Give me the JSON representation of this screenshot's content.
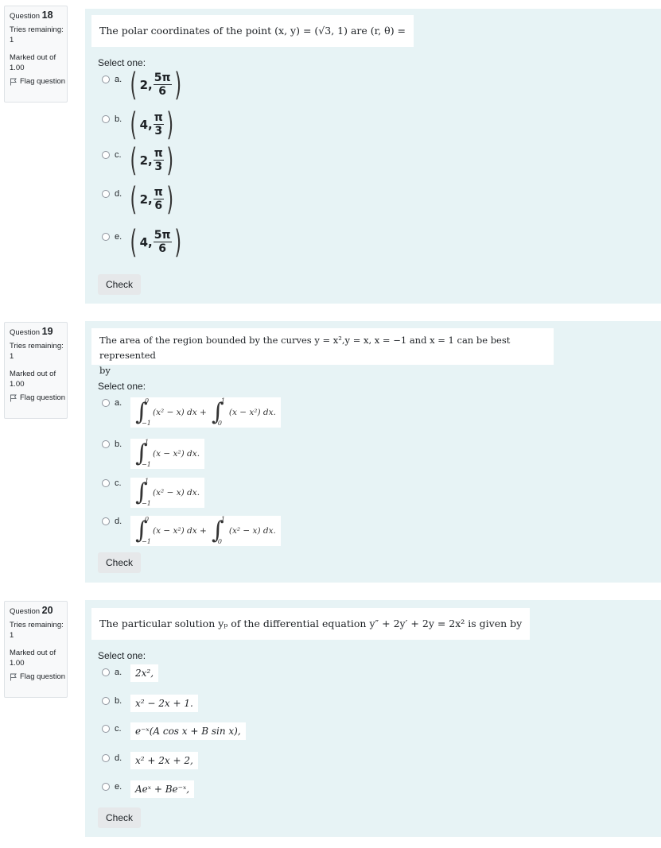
{
  "questions": [
    {
      "info": {
        "question_label": "Question",
        "number": "18",
        "tries_label": "Tries remaining:",
        "tries_value": "1",
        "marked_label": "Marked out of",
        "marked_value": "1.00",
        "flag_label": "Flag question"
      },
      "text": "The polar coordinates of the point (x, y) = (√3, 1) are (r, θ) =",
      "select_label": "Select one:",
      "options": [
        {
          "letter": "a.",
          "r": "2",
          "num": "5π",
          "den": "6"
        },
        {
          "letter": "b.",
          "r": "4",
          "num": "π",
          "den": "3"
        },
        {
          "letter": "c.",
          "r": "2",
          "num": "π",
          "den": "3"
        },
        {
          "letter": "d.",
          "r": "2",
          "num": "π",
          "den": "6"
        },
        {
          "letter": "e.",
          "r": "4",
          "num": "5π",
          "den": "6"
        }
      ],
      "check_label": "Check"
    },
    {
      "info": {
        "question_label": "Question",
        "number": "19",
        "tries_label": "Tries remaining:",
        "tries_value": "1",
        "marked_label": "Marked out of",
        "marked_value": "1.00",
        "flag_label": "Flag question"
      },
      "text_line1": "The area of the region bounded by the curves y = x²,y = x, x = −1 and x = 1 can be best represented",
      "text_line2": "by",
      "select_label": "Select one:",
      "options": [
        {
          "letter": "a.",
          "int1": {
            "upper": "0",
            "lower": "−1",
            "body": "(x² − x) dx +"
          },
          "int2": {
            "upper": "1",
            "lower": "0",
            "body": "(x − x²) dx."
          }
        },
        {
          "letter": "b.",
          "int1": {
            "upper": "1",
            "lower": "−1",
            "body": "(x − x²) dx."
          }
        },
        {
          "letter": "c.",
          "int1": {
            "upper": "1",
            "lower": "−1",
            "body": "(x² − x) dx."
          }
        },
        {
          "letter": "d.",
          "int1": {
            "upper": "0",
            "lower": "−1",
            "body": "(x − x²) dx +"
          },
          "int2": {
            "upper": "1",
            "lower": "0",
            "body": "(x² − x) dx."
          }
        }
      ],
      "check_label": "Check"
    },
    {
      "info": {
        "question_label": "Question",
        "number": "20",
        "tries_label": "Tries remaining:",
        "tries_value": "1",
        "marked_label": "Marked out of",
        "marked_value": "1.00",
        "flag_label": "Flag question"
      },
      "text": "The particular solution yₚ of the differential equation y″ + 2y′ + 2y = 2x² is given by",
      "select_label": "Select one:",
      "options": [
        {
          "letter": "a.",
          "text": "2x²,"
        },
        {
          "letter": "b.",
          "text": "x² − 2x + 1."
        },
        {
          "letter": "c.",
          "text": "e⁻ˣ(A cos x + B sin x),"
        },
        {
          "letter": "d.",
          "text": "x² + 2x + 2,"
        },
        {
          "letter": "e.",
          "text": "Aeˣ + Be⁻ˣ,"
        }
      ],
      "check_label": "Check"
    }
  ]
}
